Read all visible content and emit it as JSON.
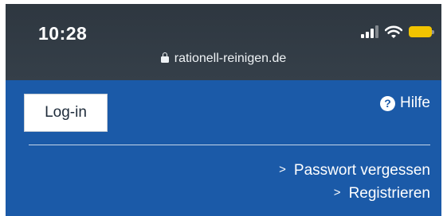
{
  "status_bar": {
    "time": "10:28",
    "url": "rationell-reinigen.de"
  },
  "icons": {
    "lock": "lock-icon",
    "signal": "cellular-signal-icon",
    "wifi": "wifi-icon",
    "battery": "battery-icon",
    "help": "question-circle-icon",
    "chevron": "chevron-right-icon"
  },
  "colors": {
    "page_background": "#1b5aa8",
    "status_bar": "#323b45",
    "battery": "#f2c400"
  },
  "header": {
    "login_label": "Log-in",
    "help_label": "Hilfe",
    "help_glyph": "?"
  },
  "links": {
    "chevron_glyph": ">",
    "forgot_password": "Passwort vergessen",
    "register": "Registrieren"
  }
}
